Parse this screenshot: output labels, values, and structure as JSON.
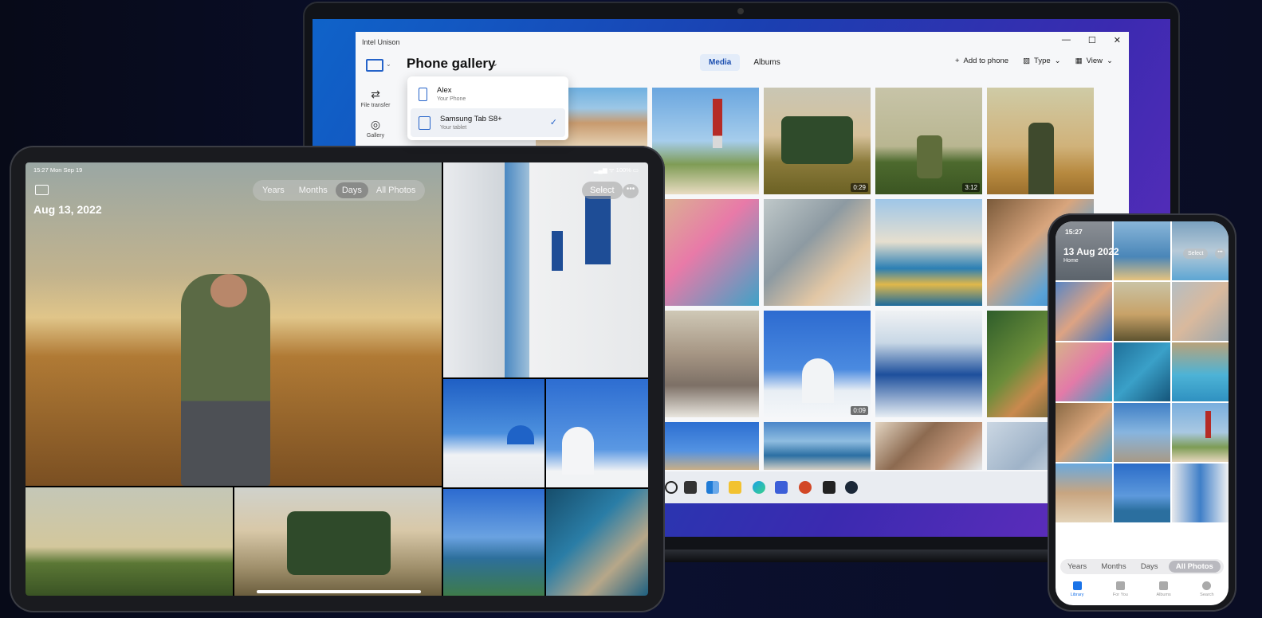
{
  "laptop": {
    "app_title": "Intel Unison",
    "window_controls": [
      "—",
      "☐",
      "✕"
    ],
    "sidebar": [
      {
        "label": "File transfer",
        "icon": "file-transfer-icon",
        "glyph": "⇄"
      },
      {
        "label": "Gallery",
        "icon": "gallery-icon",
        "glyph": "◎"
      }
    ],
    "gallery_title": "Phone gallery",
    "gallery_chevron": "⌄",
    "tabs": [
      {
        "label": "Media",
        "active": true
      },
      {
        "label": "Albums",
        "active": false
      }
    ],
    "toolbar": {
      "add_label": "Add to phone",
      "type_label": "Type",
      "view_label": "View"
    },
    "device_dropdown": [
      {
        "name": "Alex",
        "sub": "Your Phone",
        "selected": false
      },
      {
        "name": "Samsung Tab S8+",
        "sub": "Your tablet",
        "selected": true
      }
    ],
    "check_glyph": "✓",
    "video_durations": [
      "0:29",
      "3:12",
      "0:09"
    ]
  },
  "tablet": {
    "status_left": "15:27  Mon Sep 19",
    "status_right": "▂▄▆ ᯤ 100% ▭",
    "segments": [
      {
        "label": "Years",
        "active": false
      },
      {
        "label": "Months",
        "active": false
      },
      {
        "label": "Days",
        "active": true
      },
      {
        "label": "All Photos",
        "active": false
      }
    ],
    "date": "Aug 13, 2022",
    "select_label": "Select",
    "more_glyph": "•••"
  },
  "phone": {
    "status_time": "15:27",
    "title": "13 Aug 2022",
    "subtitle": "Home",
    "select_label": "Select",
    "more_glyph": "•••",
    "segments": [
      {
        "label": "Years",
        "active": false
      },
      {
        "label": "Months",
        "active": false
      },
      {
        "label": "Days",
        "active": false
      },
      {
        "label": "All Photos",
        "active": true
      }
    ],
    "tabbar": [
      {
        "label": "Library",
        "active": true
      },
      {
        "label": "For You",
        "active": false
      },
      {
        "label": "Albums",
        "active": false
      },
      {
        "label": "Search",
        "active": false
      }
    ]
  },
  "colors": {
    "accent": "#2563c9",
    "tab_active_bg": "#e3ecf9",
    "phone_accent": "#1a73e8"
  }
}
